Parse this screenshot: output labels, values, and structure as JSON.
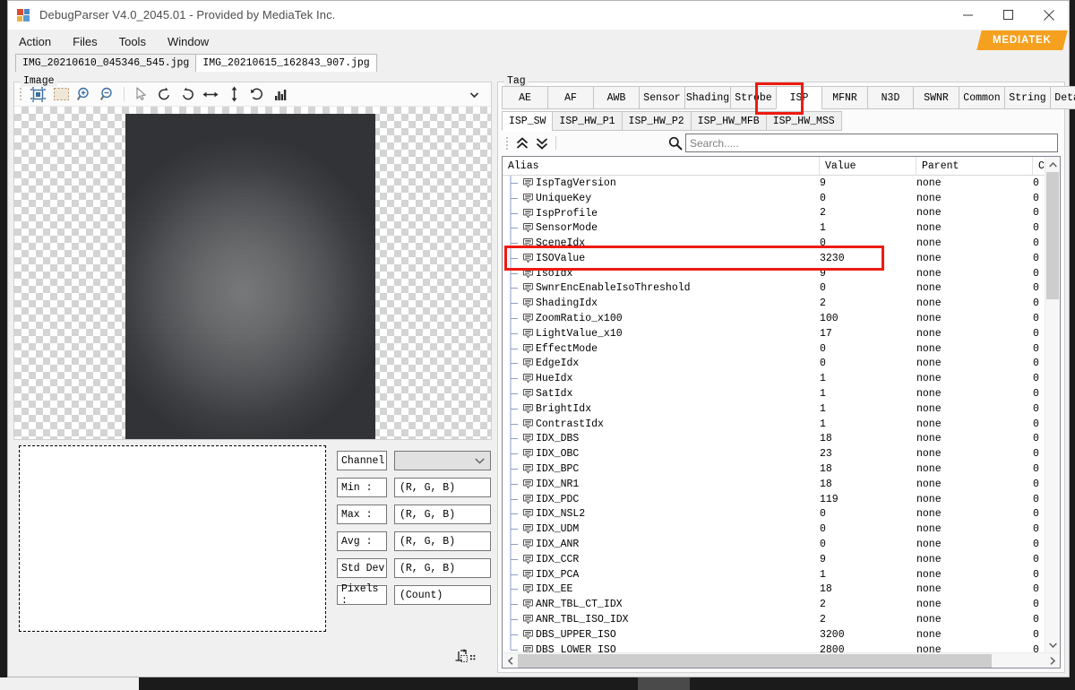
{
  "window": {
    "title": "DebugParser V4.0_2045.01 - Provided by MediaTek Inc.",
    "brand": "MEDIATEK",
    "controls": {
      "minimize": "minimize-icon",
      "maximize": "maximize-icon",
      "close": "close-icon"
    }
  },
  "menu": {
    "items": [
      "Action",
      "Files",
      "Tools",
      "Window"
    ]
  },
  "doc_tabs": [
    {
      "label": "IMG_20210610_045346_545.jpg",
      "active": false
    },
    {
      "label": "IMG_20210615_162843_907.jpg",
      "active": true
    }
  ],
  "image_panel": {
    "group_label": "Image",
    "toolbar": [
      "fit-to-window-icon",
      "select-region-icon",
      "zoom-in-icon",
      "zoom-out-icon",
      "pointer-icon",
      "rotate-left-icon",
      "rotate-right-icon",
      "flip-horizontal-icon",
      "flip-vertical-icon",
      "reset-icon",
      "histogram-icon"
    ],
    "overflow_caret": "chevron-down-icon"
  },
  "stats": {
    "channel_label": "Channel",
    "channel_value": "",
    "rows": [
      {
        "label": "Min :",
        "value": "(R, G, B)"
      },
      {
        "label": "Max :",
        "value": "(R, G, B)"
      },
      {
        "label": "Avg :",
        "value": "(R, G, B)"
      },
      {
        "label": "Std Dev",
        "value": "(R, G, B)"
      },
      {
        "label": "Pixels :",
        "value": "(Count)"
      }
    ]
  },
  "tag_panel": {
    "group_label": "Tag",
    "main_tabs": [
      {
        "label": "AE",
        "active": false
      },
      {
        "label": "AF",
        "active": false
      },
      {
        "label": "AWB",
        "active": false
      },
      {
        "label": "Sensor",
        "active": false
      },
      {
        "label": "Shading",
        "active": false
      },
      {
        "label": "Strobe",
        "active": false
      },
      {
        "label": "ISP",
        "active": true
      },
      {
        "label": "MFNR",
        "active": false
      },
      {
        "label": "N3D",
        "active": false
      },
      {
        "label": "SWNR",
        "active": false
      },
      {
        "label": "Common",
        "active": false
      },
      {
        "label": "String",
        "active": false
      },
      {
        "label": "Detail",
        "active": false
      }
    ],
    "sub_tabs": [
      {
        "label": "ISP_SW",
        "active": true
      },
      {
        "label": "ISP_HW_P1",
        "active": false
      },
      {
        "label": "ISP_HW_P2",
        "active": false
      },
      {
        "label": "ISP_HW_MFB",
        "active": false
      },
      {
        "label": "ISP_HW_MSS",
        "active": false
      }
    ],
    "toolbar": {
      "collapse_all": "chevrons-up-icon",
      "expand_all": "chevrons-down-icon",
      "search_icon": "search-icon",
      "search_value": "",
      "search_placeholder": "Search....."
    },
    "columns": [
      "Alias",
      "Value",
      "Parent",
      "Chi"
    ],
    "highlight_color": "#ee1b10",
    "highlighted_alias": "ISOValue",
    "rows": [
      {
        "alias": "IspTagVersion",
        "value": "9",
        "parent": "none",
        "chi": "0"
      },
      {
        "alias": "UniqueKey",
        "value": "0",
        "parent": "none",
        "chi": "0"
      },
      {
        "alias": "IspProfile",
        "value": "2",
        "parent": "none",
        "chi": "0"
      },
      {
        "alias": "SensorMode",
        "value": "1",
        "parent": "none",
        "chi": "0"
      },
      {
        "alias": "SceneIdx",
        "value": "0",
        "parent": "none",
        "chi": "0"
      },
      {
        "alias": "ISOValue",
        "value": "3230",
        "parent": "none",
        "chi": "0"
      },
      {
        "alias": "IsoIdx",
        "value": "9",
        "parent": "none",
        "chi": "0"
      },
      {
        "alias": "SwnrEncEnableIsoThreshold",
        "value": "0",
        "parent": "none",
        "chi": "0"
      },
      {
        "alias": "ShadingIdx",
        "value": "2",
        "parent": "none",
        "chi": "0"
      },
      {
        "alias": "ZoomRatio_x100",
        "value": "100",
        "parent": "none",
        "chi": "0"
      },
      {
        "alias": "LightValue_x10",
        "value": "17",
        "parent": "none",
        "chi": "0"
      },
      {
        "alias": "EffectMode",
        "value": "0",
        "parent": "none",
        "chi": "0"
      },
      {
        "alias": "EdgeIdx",
        "value": "0",
        "parent": "none",
        "chi": "0"
      },
      {
        "alias": "HueIdx",
        "value": "1",
        "parent": "none",
        "chi": "0"
      },
      {
        "alias": "SatIdx",
        "value": "1",
        "parent": "none",
        "chi": "0"
      },
      {
        "alias": "BrightIdx",
        "value": "1",
        "parent": "none",
        "chi": "0"
      },
      {
        "alias": "ContrastIdx",
        "value": "1",
        "parent": "none",
        "chi": "0"
      },
      {
        "alias": "IDX_DBS",
        "value": "18",
        "parent": "none",
        "chi": "0"
      },
      {
        "alias": "IDX_OBC",
        "value": "23",
        "parent": "none",
        "chi": "0"
      },
      {
        "alias": "IDX_BPC",
        "value": "18",
        "parent": "none",
        "chi": "0"
      },
      {
        "alias": "IDX_NR1",
        "value": "18",
        "parent": "none",
        "chi": "0"
      },
      {
        "alias": "IDX_PDC",
        "value": "119",
        "parent": "none",
        "chi": "0"
      },
      {
        "alias": "IDX_NSL2",
        "value": "0",
        "parent": "none",
        "chi": "0"
      },
      {
        "alias": "IDX_UDM",
        "value": "0",
        "parent": "none",
        "chi": "0"
      },
      {
        "alias": "IDX_ANR",
        "value": "0",
        "parent": "none",
        "chi": "0"
      },
      {
        "alias": "IDX_CCR",
        "value": "9",
        "parent": "none",
        "chi": "0"
      },
      {
        "alias": "IDX_PCA",
        "value": "1",
        "parent": "none",
        "chi": "0"
      },
      {
        "alias": "IDX_EE",
        "value": "18",
        "parent": "none",
        "chi": "0"
      },
      {
        "alias": "ANR_TBL_CT_IDX",
        "value": "2",
        "parent": "none",
        "chi": "0"
      },
      {
        "alias": "ANR_TBL_ISO_IDX",
        "value": "2",
        "parent": "none",
        "chi": "0"
      },
      {
        "alias": "DBS_UPPER_ISO",
        "value": "3200",
        "parent": "none",
        "chi": "0"
      },
      {
        "alias": "DBS_LOWER_ISO",
        "value": "2800",
        "parent": "none",
        "chi": "0"
      }
    ]
  }
}
